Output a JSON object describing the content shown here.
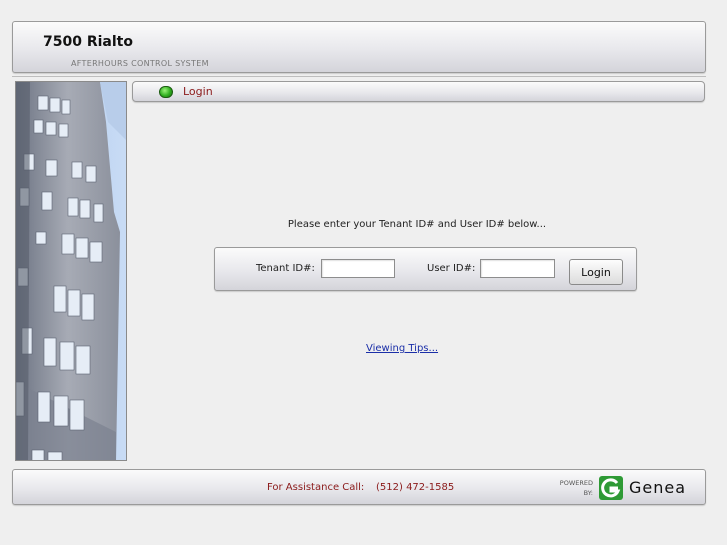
{
  "header": {
    "title": "7500 Rialto",
    "subtitle": "AFTERHOURS CONTROL SYSTEM"
  },
  "tab": {
    "label": "Login",
    "indicator_color": "#2fae1f"
  },
  "login": {
    "instructions": "Please enter your Tenant ID# and User ID# below...",
    "tenant_label": "Tenant ID#:",
    "tenant_value": "",
    "user_label": "User ID#:",
    "user_value": "",
    "button_label": "Login"
  },
  "links": {
    "viewing_tips": "Viewing Tips..."
  },
  "footer": {
    "assistance_label": "For Assistance Call:",
    "assistance_phone": "(512) 472-1585",
    "powered_line1": "POWERED",
    "powered_line2": "BY:",
    "brand": "Genea",
    "brand_color": "#2e9a35"
  },
  "colors": {
    "accent_text": "#8b1a1a",
    "link": "#1b2fa8"
  },
  "icons": {
    "status": "green-led-icon",
    "brand": "genea-logo-icon",
    "photo": "building-photo"
  }
}
